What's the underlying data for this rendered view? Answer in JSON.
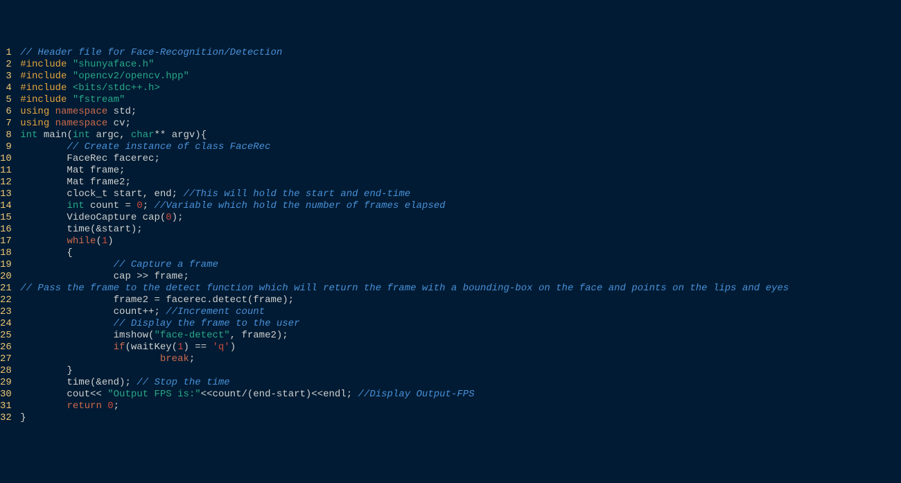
{
  "lines": [
    [
      {
        "t": "// Header file for Face-Recognition/Detection",
        "c": "comment"
      }
    ],
    [
      {
        "t": "#include",
        "c": "preproc"
      },
      {
        "t": " ",
        "c": ""
      },
      {
        "t": "\"shunyaface.h\"",
        "c": "string"
      }
    ],
    [
      {
        "t": "#include",
        "c": "preproc"
      },
      {
        "t": " ",
        "c": ""
      },
      {
        "t": "\"opencv2/opencv.hpp\"",
        "c": "string"
      }
    ],
    [
      {
        "t": "#include",
        "c": "preproc"
      },
      {
        "t": " ",
        "c": ""
      },
      {
        "t": "<bits/stdc++.h>",
        "c": "angle"
      }
    ],
    [
      {
        "t": "#include",
        "c": "preproc"
      },
      {
        "t": " ",
        "c": ""
      },
      {
        "t": "\"fstream\"",
        "c": "string"
      }
    ],
    [
      {
        "t": "using",
        "c": "keyword"
      },
      {
        "t": " ",
        "c": ""
      },
      {
        "t": "namespace",
        "c": "kw2"
      },
      {
        "t": " std;",
        "c": "ident"
      }
    ],
    [
      {
        "t": "using",
        "c": "keyword"
      },
      {
        "t": " ",
        "c": ""
      },
      {
        "t": "namespace",
        "c": "kw2"
      },
      {
        "t": " cv;",
        "c": "ident"
      }
    ],
    [
      {
        "t": "int",
        "c": "type"
      },
      {
        "t": " main(",
        "c": "ident"
      },
      {
        "t": "int",
        "c": "type"
      },
      {
        "t": " argc, ",
        "c": "ident"
      },
      {
        "t": "char",
        "c": "type"
      },
      {
        "t": "** argv){",
        "c": "ident"
      }
    ],
    [
      {
        "t": "        ",
        "c": ""
      },
      {
        "t": "// Create instance of class FaceRec",
        "c": "comment"
      }
    ],
    [
      {
        "t": "        FaceRec facerec;",
        "c": "ident"
      }
    ],
    [
      {
        "t": "        Mat frame;",
        "c": "ident"
      }
    ],
    [
      {
        "t": "        Mat frame2;",
        "c": "ident"
      }
    ],
    [
      {
        "t": "        clock_t start, end; ",
        "c": "ident"
      },
      {
        "t": "//This will hold the start and end-time",
        "c": "comment"
      }
    ],
    [
      {
        "t": "        ",
        "c": ""
      },
      {
        "t": "int",
        "c": "type"
      },
      {
        "t": " count = ",
        "c": "ident"
      },
      {
        "t": "0",
        "c": "num"
      },
      {
        "t": "; ",
        "c": "ident"
      },
      {
        "t": "//Variable which hold the number of frames elapsed",
        "c": "comment"
      }
    ],
    [
      {
        "t": "        VideoCapture cap(",
        "c": "ident"
      },
      {
        "t": "0",
        "c": "num"
      },
      {
        "t": ");",
        "c": "ident"
      }
    ],
    [
      {
        "t": "        time(&start);",
        "c": "ident"
      }
    ],
    [
      {
        "t": "        ",
        "c": ""
      },
      {
        "t": "while",
        "c": "kw2"
      },
      {
        "t": "(",
        "c": "ident"
      },
      {
        "t": "1",
        "c": "num"
      },
      {
        "t": ")",
        "c": "ident"
      }
    ],
    [
      {
        "t": "        {",
        "c": "ident"
      }
    ],
    [
      {
        "t": "                ",
        "c": ""
      },
      {
        "t": "// Capture a frame",
        "c": "comment"
      }
    ],
    [
      {
        "t": "                cap >> frame;",
        "c": "ident"
      }
    ],
    [
      {
        "t": "// Pass the frame to the detect function which will return the frame with a bounding-box on the face and points on the lips and eyes",
        "c": "comment"
      }
    ],
    [
      {
        "t": "                frame2 = facerec.detect(frame);",
        "c": "ident"
      }
    ],
    [
      {
        "t": "                count++; ",
        "c": "ident"
      },
      {
        "t": "//Increment count",
        "c": "comment"
      }
    ],
    [
      {
        "t": "                ",
        "c": ""
      },
      {
        "t": "// Display the frame to the user",
        "c": "comment"
      }
    ],
    [
      {
        "t": "                imshow(",
        "c": "ident"
      },
      {
        "t": "\"face-detect\"",
        "c": "string"
      },
      {
        "t": ", frame2);",
        "c": "ident"
      }
    ],
    [
      {
        "t": "                ",
        "c": ""
      },
      {
        "t": "if",
        "c": "kw2"
      },
      {
        "t": "(waitKey(",
        "c": "ident"
      },
      {
        "t": "1",
        "c": "num"
      },
      {
        "t": ") == ",
        "c": "ident"
      },
      {
        "t": "'q'",
        "c": "char"
      },
      {
        "t": ")",
        "c": "ident"
      }
    ],
    [
      {
        "t": "                        ",
        "c": ""
      },
      {
        "t": "break",
        "c": "kw2"
      },
      {
        "t": ";",
        "c": "ident"
      }
    ],
    [
      {
        "t": "        }",
        "c": "ident"
      }
    ],
    [
      {
        "t": "        time(&end); ",
        "c": "ident"
      },
      {
        "t": "// Stop the time",
        "c": "comment"
      }
    ],
    [
      {
        "t": "        cout<< ",
        "c": "ident"
      },
      {
        "t": "\"Output FPS is:\"",
        "c": "string"
      },
      {
        "t": "<<count/(end-start)<<endl; ",
        "c": "ident"
      },
      {
        "t": "//Display Output-FPS",
        "c": "comment"
      }
    ],
    [
      {
        "t": "        ",
        "c": ""
      },
      {
        "t": "return",
        "c": "kw2"
      },
      {
        "t": " ",
        "c": "ident"
      },
      {
        "t": "0",
        "c": "num"
      },
      {
        "t": ";",
        "c": "ident"
      }
    ],
    [
      {
        "t": "}",
        "c": "ident"
      }
    ]
  ]
}
